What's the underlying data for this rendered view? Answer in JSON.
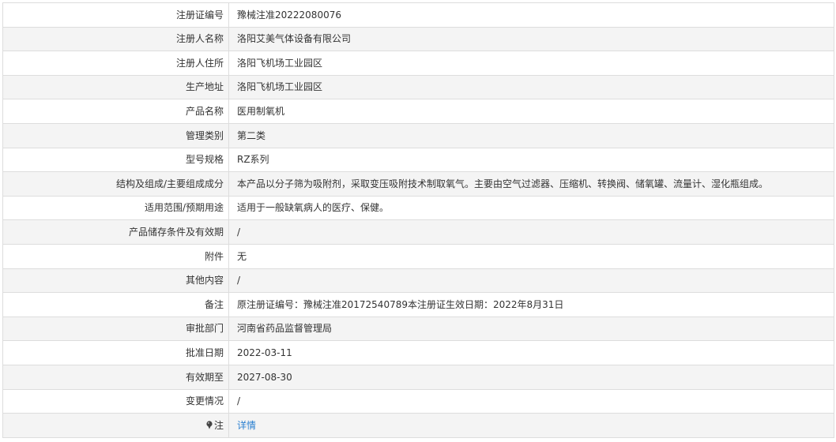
{
  "rows": [
    {
      "label": "注册证编号",
      "value": "豫械注准20222080076"
    },
    {
      "label": "注册人名称",
      "value": "洛阳艾美气体设备有限公司"
    },
    {
      "label": "注册人住所",
      "value": "洛阳飞机场工业园区"
    },
    {
      "label": "生产地址",
      "value": "洛阳飞机场工业园区"
    },
    {
      "label": "产品名称",
      "value": "医用制氧机"
    },
    {
      "label": "管理类别",
      "value": "第二类"
    },
    {
      "label": "型号规格",
      "value": "RZ系列"
    },
    {
      "label": "结构及组成/主要组成成分",
      "value": "本产品以分子筛为吸附剂，采取变压吸附技术制取氧气。主要由空气过滤器、压缩机、转换阀、储氧罐、流量计、湿化瓶组成。"
    },
    {
      "label": "适用范围/预期用途",
      "value": "适用于一般缺氧病人的医疗、保健。"
    },
    {
      "label": "产品储存条件及有效期",
      "value": "/"
    },
    {
      "label": "附件",
      "value": "无"
    },
    {
      "label": "其他内容",
      "value": "/"
    },
    {
      "label": "备注",
      "value": "原注册证编号：豫械注准20172540789本注册证生效日期：2022年8月31日"
    },
    {
      "label": "审批部门",
      "value": "河南省药品监督管理局"
    },
    {
      "label": "批准日期",
      "value": "2022-03-11"
    },
    {
      "label": "有效期至",
      "value": "2027-08-30"
    },
    {
      "label": "变更情况",
      "value": "/"
    }
  ],
  "note_row": {
    "icon": "pin-icon",
    "label": "注",
    "link_text": "详情",
    "link_color": "#2a7fd0"
  }
}
